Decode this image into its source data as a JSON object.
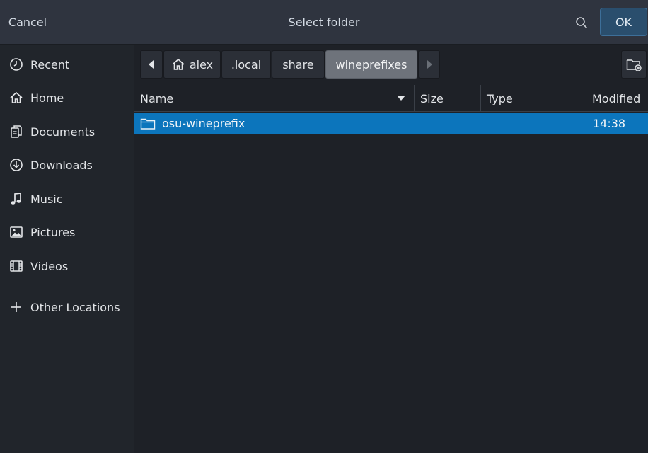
{
  "header": {
    "cancel_label": "Cancel",
    "title": "Select folder",
    "search_icon": "search-icon",
    "ok_label": "OK"
  },
  "sidebar": {
    "items": [
      {
        "label": "Recent",
        "icon": "clock-icon"
      },
      {
        "label": "Home",
        "icon": "home-icon"
      },
      {
        "label": "Documents",
        "icon": "documents-icon"
      },
      {
        "label": "Downloads",
        "icon": "download-icon"
      },
      {
        "label": "Music",
        "icon": "music-note-icon"
      },
      {
        "label": "Pictures",
        "icon": "picture-icon"
      },
      {
        "label": "Videos",
        "icon": "film-icon"
      }
    ],
    "other_locations": {
      "label": "Other Locations",
      "icon": "plus-icon"
    }
  },
  "pathbar": {
    "segments": [
      "alex",
      ".local",
      "share",
      "wineprefixes"
    ],
    "active_segment": "wineprefixes"
  },
  "columns": [
    "Name",
    "Size",
    "Type",
    "Modified"
  ],
  "files": [
    {
      "name": "osu-wineprefix",
      "size": "",
      "type": "",
      "modified": "14:38",
      "selected": true
    }
  ],
  "colors": {
    "accent": "#0c75bc",
    "ok_button": "#2a4e6d",
    "header_bg": "#2f343f",
    "content_bg": "#1e2127"
  }
}
